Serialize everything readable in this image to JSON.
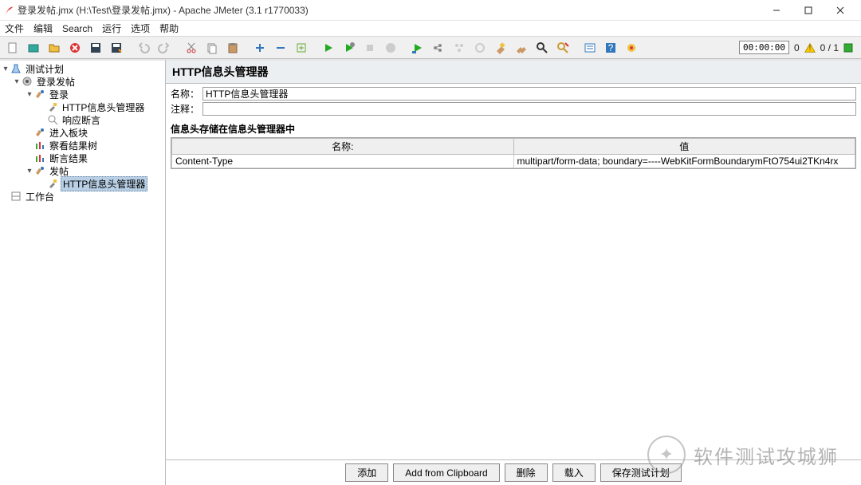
{
  "window": {
    "title": "登录发帖.jmx (H:\\Test\\登录发帖.jmx) - Apache JMeter (3.1 r1770033)"
  },
  "menu": {
    "file": "文件",
    "edit": "编辑",
    "search": "Search",
    "run": "运行",
    "options": "选项",
    "help": "帮助"
  },
  "toolbar_status": {
    "timer": "00:00:00",
    "warning_count": "0",
    "active_threads": "0 / 1"
  },
  "tree": {
    "root": "测试计划",
    "thread_group": "登录发帖",
    "login": "登录",
    "http_header_mgr1": "HTTP信息头管理器",
    "response_assert": "响应断言",
    "enter_section": "进入板块",
    "view_results_tree": "察看结果树",
    "assertion_results": "断言结果",
    "post": "发帖",
    "http_header_mgr2": "HTTP信息头管理器",
    "workbench": "工作台"
  },
  "panel": {
    "title": "HTTP信息头管理器",
    "name_label": "名称：",
    "name_value": "HTTP信息头管理器",
    "comment_label": "注释：",
    "comment_value": "",
    "group_label": "信息头存储在信息头管理器中",
    "table": {
      "col_name": "名称:",
      "col_value": "值",
      "rows": [
        {
          "name": "Content-Type",
          "value": "multipart/form-data; boundary=----WebKitFormBoundarymFtO754ui2TKn4rx"
        }
      ]
    },
    "buttons": {
      "add": "添加",
      "add_clip": "Add from Clipboard",
      "delete": "删除",
      "load": "载入",
      "save": "保存测试计划"
    }
  },
  "watermark": {
    "text": "软件测试攻城狮"
  }
}
